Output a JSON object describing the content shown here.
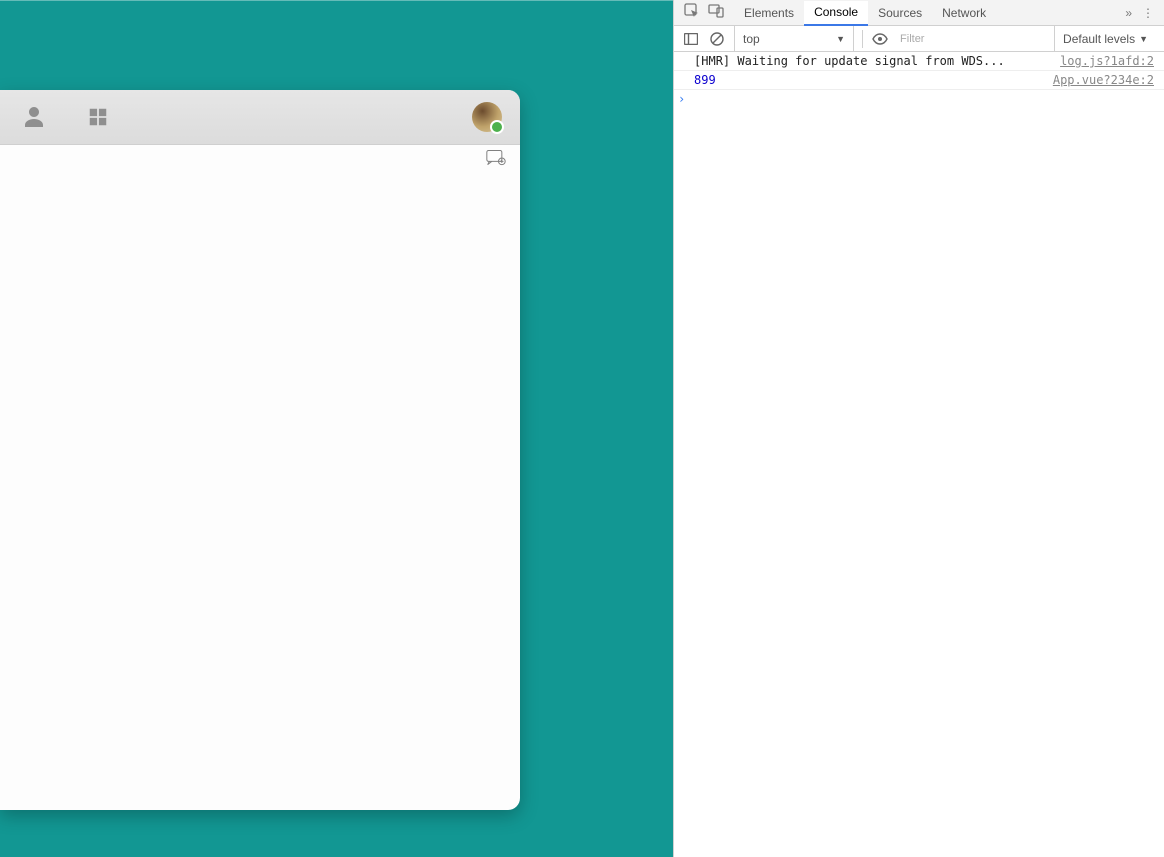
{
  "devtools": {
    "tabs": [
      "Elements",
      "Console",
      "Sources",
      "Network"
    ],
    "active_tab": "Console",
    "context": "top",
    "filter_placeholder": "Filter",
    "levels": "Default levels",
    "log_lines": [
      {
        "msg": "[HMR] Waiting for update signal from WDS...",
        "src": "log.js?1afd:2",
        "numeric": false
      },
      {
        "msg": "899",
        "src": "App.vue?234e:2",
        "numeric": true
      }
    ],
    "prompt": "›"
  },
  "app": {
    "status_color": "#4db14d"
  }
}
